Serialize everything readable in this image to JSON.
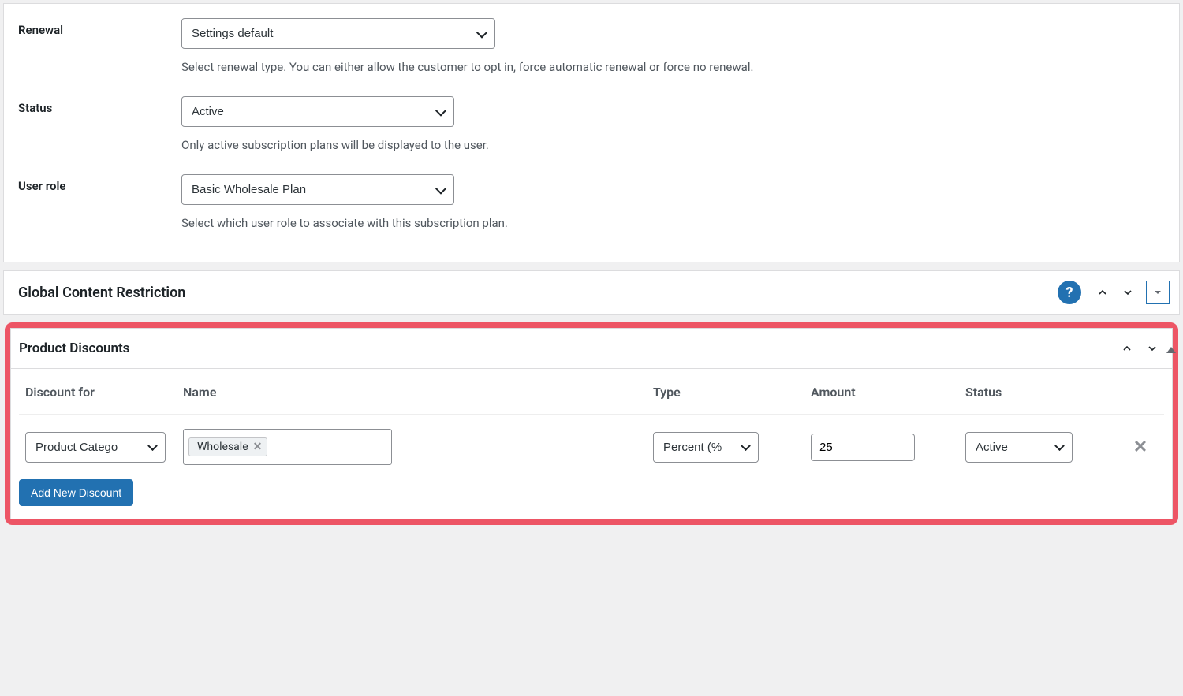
{
  "settings": {
    "renewal": {
      "label": "Renewal",
      "value": "Settings default",
      "help": "Select renewal type. You can either allow the customer to opt in, force automatic renewal or force no renewal."
    },
    "status": {
      "label": "Status",
      "value": "Active",
      "help": "Only active subscription plans will be displayed to the user."
    },
    "user_role": {
      "label": "User role",
      "value": "Basic Wholesale Plan",
      "help": "Select which user role to associate with this subscription plan."
    }
  },
  "global_restriction": {
    "title": "Global Content Restriction",
    "help_symbol": "?"
  },
  "product_discounts": {
    "title": "Product Discounts",
    "columns": {
      "discount_for": "Discount for",
      "name": "Name",
      "type": "Type",
      "amount": "Amount",
      "status": "Status"
    },
    "rows": [
      {
        "discount_for": "Product Catego",
        "name_tag": "Wholesale",
        "type": "Percent (%",
        "amount": "25",
        "status": "Active"
      }
    ],
    "add_button": "Add New Discount"
  }
}
